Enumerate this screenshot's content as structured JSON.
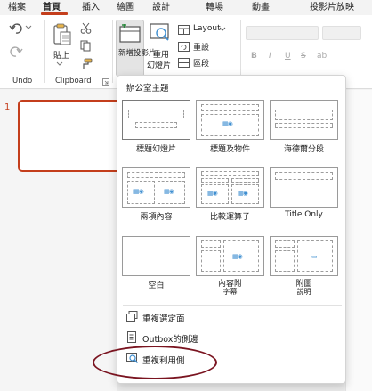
{
  "tabs": [
    "檔案",
    "首頁",
    "插入",
    "繪圖",
    "設計",
    "轉場",
    "動畫",
    "投影片放映"
  ],
  "active_tab": "首頁",
  "accent_color": "#c43e1c",
  "ribbon": {
    "undo_group_label": "Undo",
    "paste_label": "貼上",
    "clipboard_group_label": "Clipboard",
    "new_slide_label": "新增投影片",
    "reuse_slide_label": "重用",
    "reuse_slide_label2": "幻燈片",
    "layout_label": "Layout",
    "reset_label": "重設",
    "section_label": "區段",
    "format_buttons": [
      "B",
      "I",
      "U",
      "S",
      "ab"
    ]
  },
  "slide_number": "1",
  "layout_menu": {
    "title": "辦公室主題",
    "layouts": [
      {
        "name": "標題幻燈片"
      },
      {
        "name": "標題及物件"
      },
      {
        "name": "海德爾分段"
      },
      {
        "name": "兩項內容"
      },
      {
        "name": "比較運算子"
      },
      {
        "name": "Title Only"
      },
      {
        "name": "空白"
      },
      {
        "name": "內容附",
        "sub": "字幕"
      },
      {
        "name": "附圖",
        "sub": "說明"
      }
    ],
    "actions": [
      {
        "label": "重複選定面",
        "icon": "duplicate-slide-icon"
      },
      {
        "label": "Outbox的側邊",
        "icon": "outline-icon"
      },
      {
        "label": "重複利用側",
        "icon": "reuse-slides-icon"
      }
    ]
  }
}
